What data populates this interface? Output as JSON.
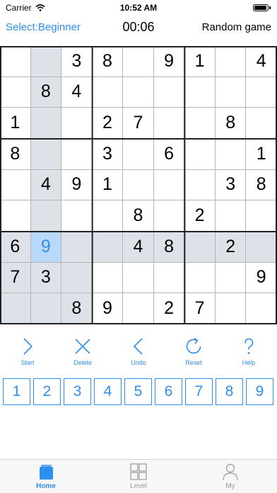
{
  "status_bar": {
    "carrier": "Carrier",
    "time": "10:52 AM"
  },
  "header": {
    "select_label": "Select:Beginner",
    "timer": "00:06",
    "random_label": "Random game"
  },
  "board": {
    "grid": [
      [
        "",
        "",
        "3",
        "8",
        "",
        "9",
        "1",
        "",
        "4"
      ],
      [
        "",
        "8",
        "4",
        "",
        "",
        "",
        "",
        "",
        ""
      ],
      [
        "1",
        "",
        "",
        "2",
        "7",
        "",
        "",
        "8",
        ""
      ],
      [
        "8",
        "",
        "",
        "3",
        "",
        "6",
        "",
        "",
        "1"
      ],
      [
        "",
        "4",
        "9",
        "1",
        "",
        "",
        "",
        "3",
        "8"
      ],
      [
        "",
        "",
        "",
        "",
        "8",
        "",
        "2",
        "",
        ""
      ],
      [
        "6",
        "9",
        "",
        "",
        "4",
        "8",
        "",
        "2",
        ""
      ],
      [
        "7",
        "3",
        "",
        "",
        "",
        "",
        "",
        "",
        "9"
      ],
      [
        "",
        "",
        "8",
        "9",
        "",
        "2",
        "7",
        "",
        ""
      ]
    ],
    "selected_row": 6,
    "selected_col": 1
  },
  "controls": [
    {
      "label": "Start",
      "icon": "chevron-right-icon"
    },
    {
      "label": "Delete",
      "icon": "x-icon"
    },
    {
      "label": "Undo",
      "icon": "chevron-left-icon"
    },
    {
      "label": "Reset",
      "icon": "refresh-icon"
    },
    {
      "label": "Help",
      "icon": "question-icon"
    }
  ],
  "numpad": [
    "1",
    "2",
    "3",
    "4",
    "5",
    "6",
    "7",
    "8",
    "9"
  ],
  "tabs": [
    {
      "label": "Home",
      "icon": "home-tab-icon",
      "active": true
    },
    {
      "label": "Level",
      "icon": "grid-tab-icon",
      "active": false
    },
    {
      "label": "My",
      "icon": "person-tab-icon",
      "active": false
    }
  ],
  "colors": {
    "accent": "#2f8fef",
    "highlight": "#dde2e9",
    "selected": "#b9d9fb"
  }
}
